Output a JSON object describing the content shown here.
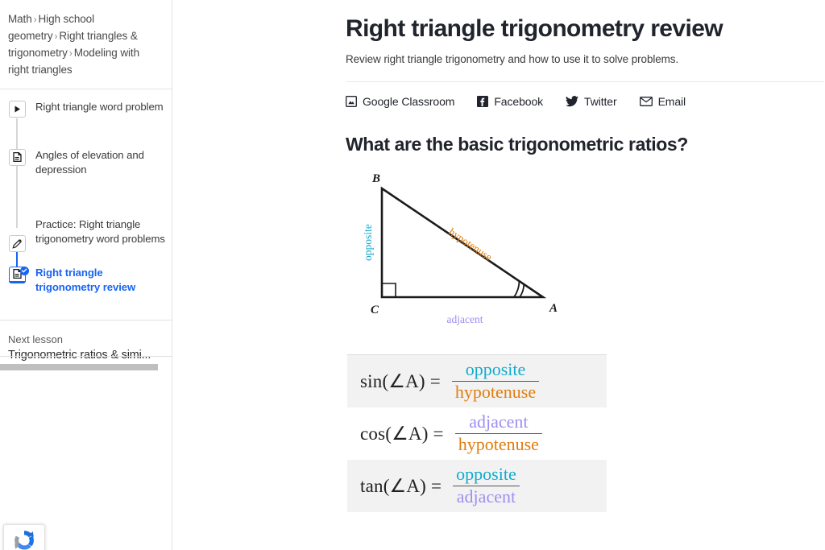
{
  "sidebar": {
    "breadcrumb": {
      "name": "breadcrumb",
      "items": [
        "Math",
        "High school geometry",
        "Right triangles & trigonometry",
        "Modeling with right triangles"
      ],
      "separator": "›"
    },
    "lessons": [
      {
        "label": "Right triangle word problem",
        "icon": "play-icon",
        "active": false,
        "completed": false
      },
      {
        "label": "Angles of elevation and depression",
        "icon": "article-icon",
        "active": false,
        "completed": false
      },
      {
        "label": "Practice: Right triangle trigonometry word problems",
        "icon": "pencil-icon",
        "active": false,
        "completed": false
      },
      {
        "label": "Right triangle trigonometry review",
        "icon": "article-icon",
        "active": true,
        "completed": true
      }
    ],
    "next_lesson": {
      "label": "Next lesson",
      "title": "Trigonometric ratios & simi..."
    },
    "recaptcha": {
      "name": "recaptcha-badge"
    },
    "accent_color": "#1865f2"
  },
  "main": {
    "title": "Right triangle trigonometry review",
    "subtitle": "Review right triangle trigonometry and how to use it to solve problems.",
    "share": [
      {
        "label": "Google Classroom",
        "icon": "google-classroom-icon"
      },
      {
        "label": "Facebook",
        "icon": "facebook-icon"
      },
      {
        "label": "Twitter",
        "icon": "twitter-icon"
      },
      {
        "label": "Email",
        "icon": "email-icon"
      }
    ],
    "section_heading": "What are the basic trigonometric ratios?",
    "figure": {
      "name": "right-triangle-diagram",
      "vertices": {
        "top_left": "B",
        "bottom_left": "C",
        "bottom_right": "A"
      },
      "labels": {
        "opposite": "opposite",
        "hypotenuse": "hypotenuse",
        "adjacent": "adjacent"
      },
      "right_angle_at": "C",
      "marked_angle_at": "A",
      "colors": {
        "opposite": "#11accd",
        "hypotenuse": "#e07d10",
        "adjacent": "#9d8ff2",
        "stroke": "#1b1b1b"
      }
    },
    "formulas": [
      {
        "function": "sin(∠A) =",
        "numerator": "opposite",
        "denominator": "hypotenuse",
        "num_color": "opposite",
        "den_color": "hypotenuse",
        "striped": true
      },
      {
        "function": "cos(∠A) =",
        "numerator": "adjacent",
        "denominator": "hypotenuse",
        "num_color": "adjacent",
        "den_color": "hypotenuse",
        "striped": false
      },
      {
        "function": "tan(∠A) =",
        "numerator": "opposite",
        "denominator": "adjacent",
        "num_color": "opposite",
        "den_color": "adjacent",
        "striped": true
      }
    ]
  }
}
